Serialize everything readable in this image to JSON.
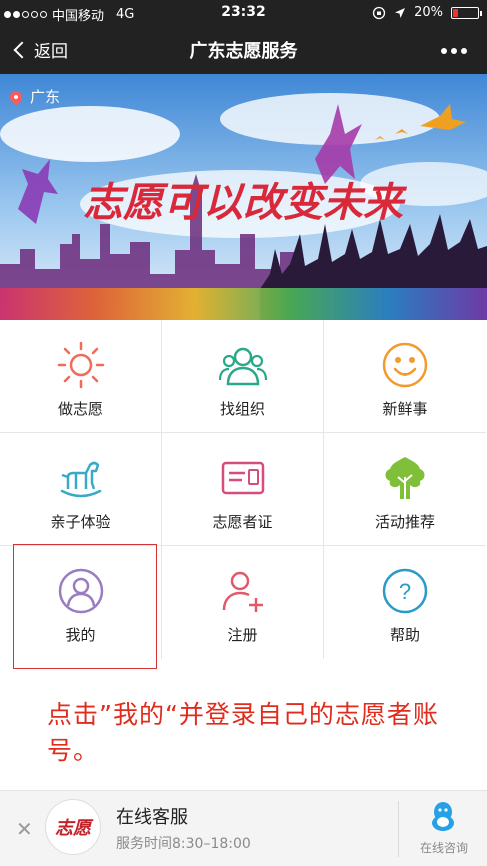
{
  "status_bar": {
    "carrier": "中国移动",
    "network": "4G",
    "time": "23:32",
    "battery": "20%",
    "battery_level": 0.2
  },
  "nav": {
    "back_label": "返回",
    "title": "广东志愿服务"
  },
  "banner": {
    "location": "广东",
    "slogan": "志愿可以改变未来"
  },
  "grid": {
    "items": [
      {
        "label": "做志愿",
        "icon": "sun-icon",
        "color": "#ef6b5a"
      },
      {
        "label": "找组织",
        "icon": "group-icon",
        "color": "#2aa889"
      },
      {
        "label": "新鲜事",
        "icon": "smile-icon",
        "color": "#f29a2e"
      },
      {
        "label": "亲子体验",
        "icon": "rocking-horse-icon",
        "color": "#3aa9c8"
      },
      {
        "label": "志愿者证",
        "icon": "id-card-icon",
        "color": "#d64d7c"
      },
      {
        "label": "活动推荐",
        "icon": "tree-icon",
        "color": "#7fbf3a"
      },
      {
        "label": "我的",
        "icon": "user-icon",
        "color": "#9a7cc0"
      },
      {
        "label": "注册",
        "icon": "add-user-icon",
        "color": "#e05a6a"
      },
      {
        "label": "帮助",
        "icon": "question-icon",
        "color": "#2a9bc8"
      }
    ]
  },
  "instruction": "点击”我的“并登录自己的志愿者账号。",
  "footer": {
    "title": "在线客服",
    "service_hours": "服务时间8:30–18:00",
    "consult_label": "在线咨询",
    "logo_text": "志愿"
  },
  "colors": {
    "bar_bg": "#222223",
    "highlight": "#d43232",
    "instruction": "#e02c1d"
  }
}
